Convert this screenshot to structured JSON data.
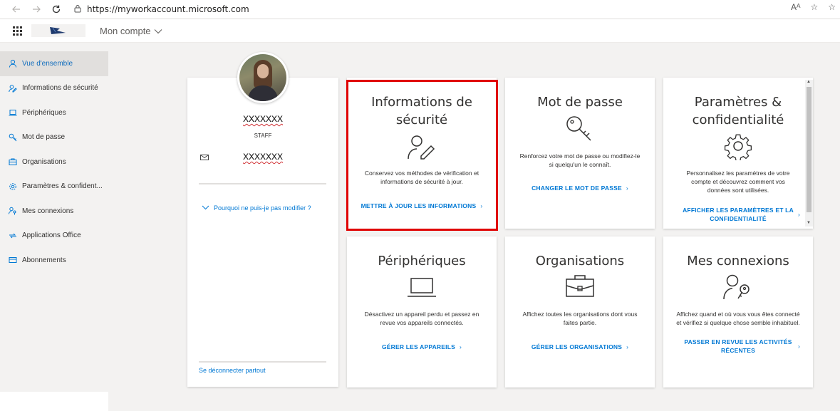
{
  "browser": {
    "url": "https://myworkaccount.microsoft.com",
    "back_icon": "arrow-left-icon",
    "forward_icon": "arrow-right-icon",
    "reload_icon": "reload-icon",
    "lock_icon": "lock-icon",
    "right_icons": [
      "read-aloud-icon",
      "favorite-add-icon",
      "favorites-icon"
    ],
    "read_aloud_label": "Aᴬ",
    "fav_add_label": "☆",
    "favorites_label": "☆"
  },
  "header": {
    "account_menu_label": "Mon compte"
  },
  "sidebar": {
    "items": [
      {
        "label": "Vue d'ensemble",
        "icon": "person-icon",
        "active": true
      },
      {
        "label": "Informations de sécurité",
        "icon": "security-info-icon",
        "active": false
      },
      {
        "label": "Périphériques",
        "icon": "laptop-icon",
        "active": false
      },
      {
        "label": "Mot de passe",
        "icon": "key-icon",
        "active": false
      },
      {
        "label": "Organisations",
        "icon": "briefcase-icon",
        "active": false
      },
      {
        "label": "Paramètres & confident...",
        "icon": "gear-icon",
        "active": false
      },
      {
        "label": "Mes connexions",
        "icon": "sign-ins-icon",
        "active": false
      },
      {
        "label": "Applications Office",
        "icon": "office-apps-icon",
        "active": false
      },
      {
        "label": "Abonnements",
        "icon": "subscriptions-icon",
        "active": false
      }
    ]
  },
  "profile": {
    "name": "XXXXXXX",
    "role": "STAFF",
    "email": "XXXXXXX",
    "why_link": "Pourquoi ne puis-je pas modifier ?",
    "signout_link": "Se déconnecter partout"
  },
  "tiles": {
    "security": {
      "title_line1": "Informations de",
      "title_line2": "sécurité",
      "desc_line1": "Conservez vos méthodes de vérification et",
      "desc_line2": "informations de sécurité à jour.",
      "link": "METTRE À JOUR LES INFORMATIONS",
      "icon": "security-info-icon"
    },
    "password": {
      "title": "Mot de passe",
      "desc_line1": "Renforcez votre mot de passe ou modifiez-le",
      "desc_line2": "si quelqu'un le connaît.",
      "link": "CHANGER LE MOT DE PASSE",
      "icon": "key-icon"
    },
    "settings": {
      "title_line1": "Paramètres &",
      "title_line2": "confidentialité",
      "desc_line1": "Personnalisez les paramètres de votre",
      "desc_line2": "compte et découvrez comment vos",
      "desc_line3": "données sont utilisées.",
      "link_line1": "AFFICHER LES PARAMÈTRES ET LA",
      "link_line2": "CONFIDENTIALITÉ",
      "icon": "gear-icon"
    },
    "devices": {
      "title": "Périphériques",
      "desc_line1": "Désactivez un appareil perdu et passez en",
      "desc_line2": "revue vos appareils connectés.",
      "link": "GÉRER LES APPAREILS",
      "icon": "laptop-icon"
    },
    "organizations": {
      "title": "Organisations",
      "desc_line1": "Affichez toutes les organisations dont vous",
      "desc_line2": "faites partie.",
      "link": "GÉRER LES ORGANISATIONS",
      "icon": "briefcase-icon"
    },
    "signins": {
      "title": "Mes connexions",
      "desc_line1": "Affichez quand et où vous vous êtes connecté",
      "desc_line2": "et vérifiez si quelque chose semble inhabituel.",
      "link_line1": "PASSER EN REVUE LES ACTIVITÉS",
      "link_line2": "RÉCENTES",
      "icon": "sign-ins-icon"
    }
  },
  "colors": {
    "accent": "#0078d4",
    "highlight": "#e00000",
    "sidebar_bg": "#f3f2f1"
  }
}
